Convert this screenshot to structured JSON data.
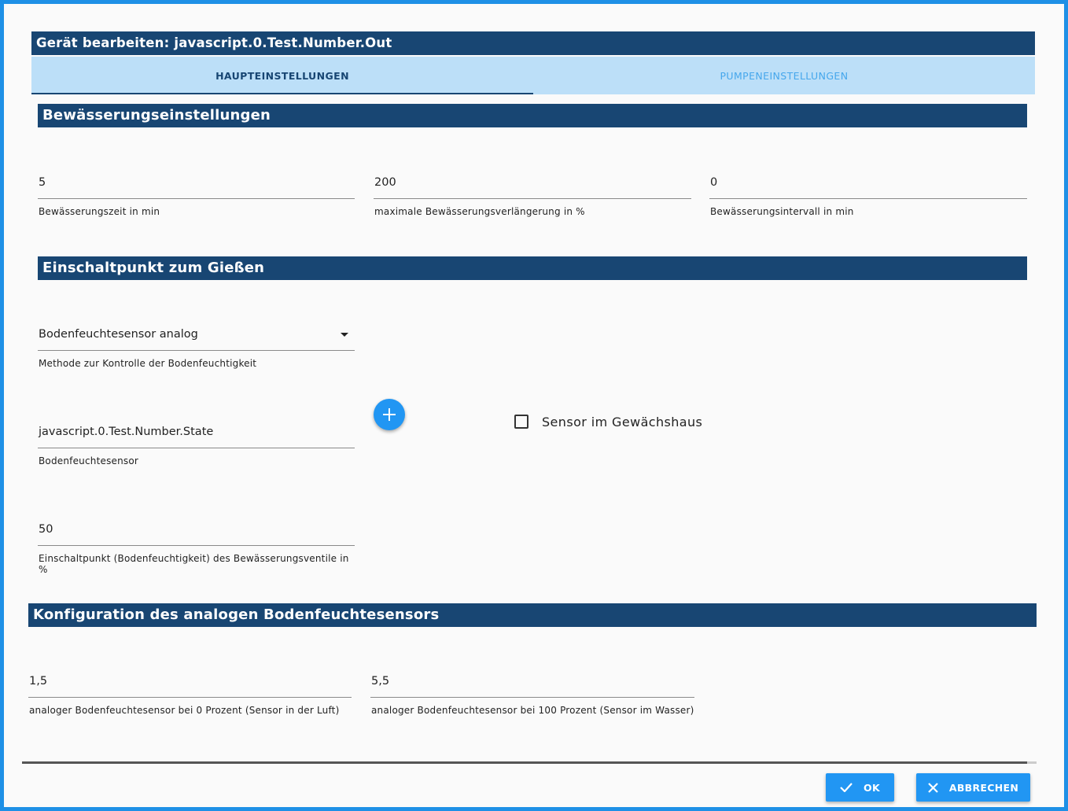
{
  "dialog": {
    "title": "Gerät bearbeiten: javascript.0.Test.Number.Out"
  },
  "tabs": [
    {
      "label": "HAUPTEINSTELLUNGEN",
      "active": true
    },
    {
      "label": "PUMPENEINSTELLUNGEN",
      "active": false
    }
  ],
  "sections": {
    "watering": {
      "title": "Bewässerungseinstellungen",
      "fields": [
        {
          "value": "5",
          "label": "Bewässerungszeit in min"
        },
        {
          "value": "200",
          "label": "maximale Bewässerungsverlängerung in %"
        },
        {
          "value": "0",
          "label": "Bewässerungsintervall in min"
        }
      ]
    },
    "switch_point": {
      "title": "Einschaltpunkt zum Gießen",
      "method_select": {
        "value": "Bodenfeuchtesensor analog",
        "label": "Methode zur Kontrolle der Bodenfeuchtigkeit"
      },
      "sensor": {
        "value": "javascript.0.Test.Number.State",
        "label": "Bodenfeuchtesensor"
      },
      "add_button_icon": "plus-icon",
      "greenhouse_checkbox": {
        "label": "Sensor im Gewächshaus",
        "checked": false
      },
      "threshold": {
        "value": "50",
        "label": "Einschaltpunkt (Bodenfeuchtigkeit) des Bewässerungsventile in %"
      }
    },
    "analog_config": {
      "title": "Konfiguration des analogen Bodenfeuchtesensors",
      "fields": [
        {
          "value": "1,5",
          "label": "analoger Bodenfeuchtesensor bei 0 Prozent (Sensor in der Luft)"
        },
        {
          "value": "5,5",
          "label": "analoger Bodenfeuchtesensor bei 100 Prozent (Sensor im Wasser)"
        }
      ]
    }
  },
  "actions": {
    "ok_label": "OK",
    "cancel_label": "ABBRECHEN"
  },
  "colors": {
    "frame": "#1e90e6",
    "header": "#184673",
    "tab_bar": "#bcdff8",
    "primary": "#2196f3"
  }
}
